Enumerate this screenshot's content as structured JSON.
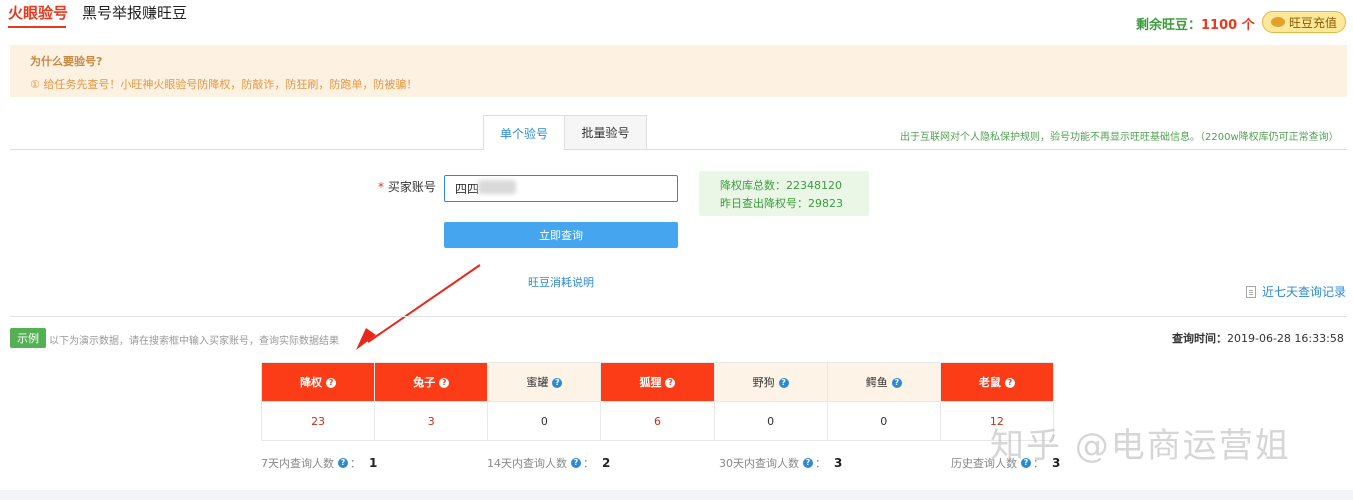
{
  "header": {
    "tabs": [
      {
        "label": "火眼验号",
        "active": true
      },
      {
        "label": "黑号举报赚旺豆",
        "active": false
      }
    ],
    "balance_label": "剩余旺豆：",
    "balance_value": "1100 个",
    "recharge_label": "旺豆充值"
  },
  "notice": {
    "title": "为什么要验号?",
    "text": "① 给任务先查号！小旺神火眼验号防降权，防敲诈，防狂刷，防跑单，防被骗！"
  },
  "mode_tabs": [
    {
      "label": "单个验号",
      "active": true
    },
    {
      "label": "批量验号",
      "active": false
    }
  ],
  "privacy_note": "出于互联网对个人隐私保护规则，验号功能不再显示旺旺基础信息。（2200w降权库仍可正常查询）",
  "form": {
    "required_mark": "*",
    "account_label": "买家账号",
    "account_value": "四四",
    "submit_label": "立即查询",
    "cost_link": "旺豆消耗说明"
  },
  "stats": {
    "total": "降权库总数：22348120",
    "yesterday": "昨日查出降权号：29823"
  },
  "history_link": "近七天查询记录",
  "example": {
    "badge": "示例",
    "text": "以下为演示数据，请在搜索框中输入买家账号，查询实际数据结果"
  },
  "query_time": {
    "label": "查询时间：",
    "value": "2019-06-28 16:33:58"
  },
  "results": [
    {
      "label": "降权",
      "value": "23",
      "highlight": true
    },
    {
      "label": "兔子",
      "value": "3",
      "highlight": true
    },
    {
      "label": "蜜罐",
      "value": "0",
      "highlight": false
    },
    {
      "label": "狐狸",
      "value": "6",
      "highlight": true
    },
    {
      "label": "野狗",
      "value": "0",
      "highlight": false
    },
    {
      "label": "鳄鱼",
      "value": "0",
      "highlight": false
    },
    {
      "label": "老鼠",
      "value": "12",
      "highlight": true
    }
  ],
  "counts": [
    {
      "label": "7天内查询人数",
      "value": "1"
    },
    {
      "label": "14天内查询人数",
      "value": "2"
    },
    {
      "label": "30天内查询人数",
      "value": "3"
    },
    {
      "label": "历史查询人数",
      "value": "3"
    }
  ],
  "watermark": "知乎 @电商运营姐",
  "colors": {
    "accent_red": "#e8381d",
    "highlight_cell": "#fb3c16",
    "link_blue": "#2d8ad2",
    "button_blue": "#46a5ef",
    "success_green": "#53b153"
  }
}
